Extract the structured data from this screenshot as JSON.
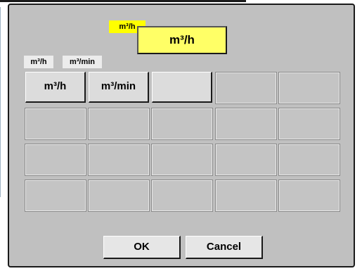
{
  "dialog": {
    "selected_tag": "m³/h",
    "selected_value": "m³/h"
  },
  "unit_tags": [
    "m³/h",
    "m³/min"
  ],
  "keypad": {
    "keys": [
      "m³/h",
      "m³/min",
      "",
      "",
      ""
    ]
  },
  "buttons": {
    "ok_label": "OK",
    "cancel_label": "Cancel"
  }
}
